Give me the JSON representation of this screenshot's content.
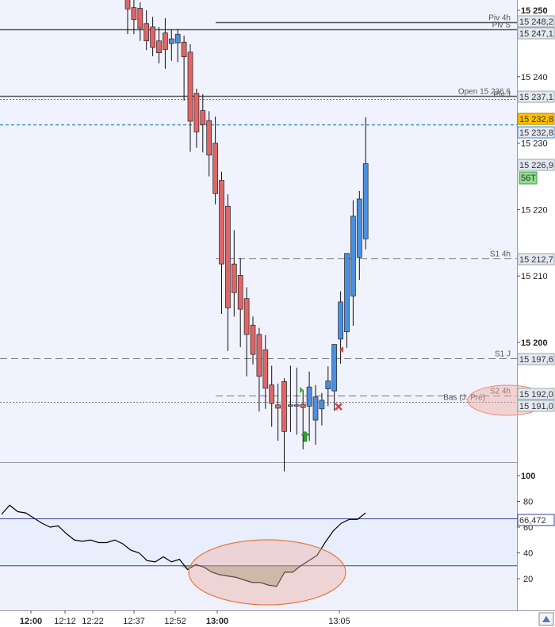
{
  "chart_data": [
    {
      "type": "candlestick",
      "x_time_labels": [
        "12:00",
        "12:12",
        "12:22",
        "12:37",
        "12:52",
        "13:00",
        "13:05"
      ],
      "y_tick_labels": [
        "15 250",
        "15 240",
        "15 230",
        "15 220",
        "15 210",
        "15 200"
      ],
      "ylim": [
        15180,
        15251
      ],
      "candles": [
        {
          "o": 15252.6,
          "h": 15253.7,
          "l": 15246.4,
          "c": 15250.2
        },
        {
          "o": 15250.4,
          "h": 15251.9,
          "l": 15246.4,
          "c": 15248.6
        },
        {
          "o": 15250.3,
          "h": 15251.2,
          "l": 15245.4,
          "c": 15247.3
        },
        {
          "o": 15248.0,
          "h": 15250.0,
          "l": 15244.0,
          "c": 15245.4
        },
        {
          "o": 15247.5,
          "h": 15249.0,
          "l": 15243.1,
          "c": 15244.4
        },
        {
          "o": 15245.4,
          "h": 15247.5,
          "l": 15242.0,
          "c": 15243.6
        },
        {
          "o": 15246.6,
          "h": 15248.8,
          "l": 15241.2,
          "c": 15244.1
        },
        {
          "o": 15245.0,
          "h": 15247.1,
          "l": 15242.4,
          "c": 15245.7
        },
        {
          "o": 15245.1,
          "h": 15247.2,
          "l": 15242.2,
          "c": 15246.4
        },
        {
          "o": 15245.2,
          "h": 15246.2,
          "l": 15236.4,
          "c": 15243.0
        },
        {
          "o": 15243.7,
          "h": 15244.9,
          "l": 15228.7,
          "c": 15233.3
        },
        {
          "o": 15237.5,
          "h": 15238.2,
          "l": 15229.3,
          "c": 15231.7
        },
        {
          "o": 15234.9,
          "h": 15237.4,
          "l": 15228.6,
          "c": 15232.8
        },
        {
          "o": 15233.4,
          "h": 15234.8,
          "l": 15225.0,
          "c": 15228.2
        },
        {
          "o": 15230.0,
          "h": 15234.0,
          "l": 15220.8,
          "c": 15222.4
        },
        {
          "o": 15224.4,
          "h": 15225.7,
          "l": 15204.3,
          "c": 15211.8
        },
        {
          "o": 15220.5,
          "h": 15222.3,
          "l": 15198.7,
          "c": 15205.2
        },
        {
          "o": 15211.8,
          "h": 15216.9,
          "l": 15203.9,
          "c": 15207.5
        },
        {
          "o": 15210.1,
          "h": 15212.7,
          "l": 15199.3,
          "c": 15205.0
        },
        {
          "o": 15206.6,
          "h": 15208.3,
          "l": 15194.9,
          "c": 15201.2
        },
        {
          "o": 15202.6,
          "h": 15203.9,
          "l": 15196.7,
          "c": 15198.2
        },
        {
          "o": 15201.2,
          "h": 15202.2,
          "l": 15189.6,
          "c": 15194.9
        },
        {
          "o": 15198.9,
          "h": 15201.1,
          "l": 15190.0,
          "c": 15193.1
        },
        {
          "o": 15193.6,
          "h": 15196.5,
          "l": 15187.3,
          "c": 15190.8
        },
        {
          "o": 15190.6,
          "h": 15193.8,
          "l": 15185.2,
          "c": 15190.1
        },
        {
          "o": 15194.1,
          "h": 15194.6,
          "l": 15180.6,
          "c": 15186.6
        },
        {
          "o": 15190.6,
          "h": 15196.5,
          "l": 15186.5,
          "c": 15190.4
        },
        {
          "o": 15190.6,
          "h": 15196.2,
          "l": 15186.1,
          "c": 15190.5
        },
        {
          "o": 15190.7,
          "h": 15192.8,
          "l": 15183.9,
          "c": 15190.2
        },
        {
          "o": 15190.4,
          "h": 15195.6,
          "l": 15185.2,
          "c": 15193.3
        },
        {
          "o": 15188.3,
          "h": 15193.6,
          "l": 15184.6,
          "c": 15191.8
        },
        {
          "o": 15190.0,
          "h": 15192.4,
          "l": 15187.5,
          "c": 15191.3
        },
        {
          "o": 15193.0,
          "h": 15196.4,
          "l": 15190.4,
          "c": 15194.2
        },
        {
          "o": 15192.7,
          "h": 15199.3,
          "l": 15189.7,
          "c": 15199.7
        },
        {
          "o": 15200.5,
          "h": 15207.7,
          "l": 15196.8,
          "c": 15206.1
        },
        {
          "o": 15201.6,
          "h": 15213.1,
          "l": 15199.2,
          "c": 15213.4
        },
        {
          "o": 15207.0,
          "h": 15221.4,
          "l": 15202.5,
          "c": 15219.0
        },
        {
          "o": 15212.8,
          "h": 15222.8,
          "l": 15209.4,
          "c": 15221.6
        },
        {
          "o": 15215.6,
          "h": 15233.9,
          "l": 15214.0,
          "c": 15226.9
        }
      ],
      "levels": [
        {
          "label": "Piv 4h",
          "value": 15248.2,
          "value_label": "15 248,2",
          "style": "solid",
          "color": "#555555"
        },
        {
          "label": "Piv S",
          "value": 15247.1,
          "value_label": "15 247,1",
          "style": "solid",
          "color": "#555555"
        },
        {
          "label": "Open 15 236,6",
          "value": 15237.1,
          "value_label": "15 237,1",
          "style": "solid",
          "color": "#555555"
        },
        {
          "label": "Piv J",
          "value": 15236.6,
          "value_label": "",
          "style": "dotted",
          "color": "#777777"
        },
        {
          "label": "S1 4h",
          "value": 15212.7,
          "value_label": "15 212,7",
          "style": "dashed",
          "color": "#777777"
        },
        {
          "label": "S1 J",
          "value": 15197.6,
          "value_label": "15 197,6",
          "style": "dashed",
          "color": "#777777"
        },
        {
          "label": "S2 4h",
          "value": 15192.0,
          "value_label": "15 192,0",
          "style": "dashed",
          "color": "#777777"
        },
        {
          "label": "Bas (J. Pré)",
          "value": 15191.0,
          "value_label": "15 191,0",
          "style": "dotted",
          "color": "#777777"
        }
      ],
      "last_price": {
        "value": 15232.8,
        "label": "15 232,8",
        "color": "#ffc000"
      },
      "last_price_secondary": {
        "value": 15232.8,
        "label": "15 232,8"
      },
      "current_close": {
        "value": 15226.9,
        "label": "15 226,9"
      },
      "timer_label": "56T",
      "colors": {
        "bull": "#4a90e2",
        "bear": "#e06666",
        "bg": "#f0f2fd"
      }
    },
    {
      "type": "line",
      "ylim": [
        5,
        100
      ],
      "y_tick_labels": [
        "100",
        "80",
        "60",
        "40",
        "20"
      ],
      "hlines": [
        30,
        66.472
      ],
      "current_label": "66,472",
      "values": [
        70,
        77,
        72,
        71,
        67,
        63,
        60,
        61,
        55,
        50,
        49,
        50,
        48,
        48,
        50,
        47,
        42,
        40,
        34,
        33,
        37,
        33,
        35,
        27,
        31,
        29,
        25,
        23,
        22,
        21,
        19,
        17,
        17,
        15,
        14,
        25,
        25,
        30,
        34,
        38,
        48,
        57,
        63,
        66,
        66,
        71
      ],
      "colors": {
        "line": "#000000",
        "band": "#e8eefc",
        "shade": "#b8c4b0"
      }
    }
  ]
}
